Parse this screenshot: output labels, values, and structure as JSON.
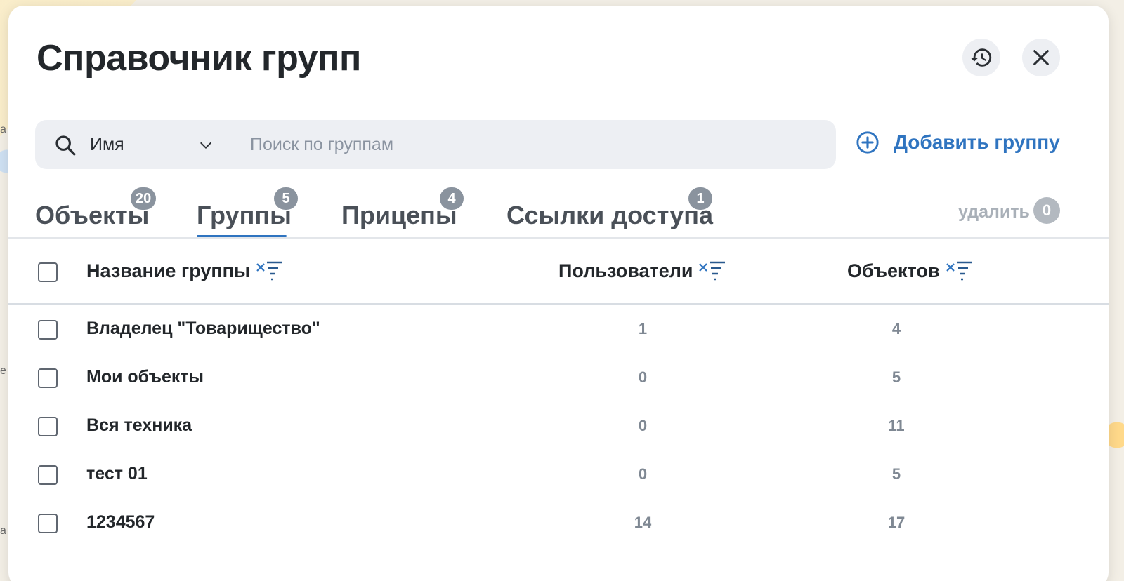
{
  "header": {
    "title": "Справочник групп"
  },
  "search": {
    "field_value": "Имя",
    "placeholder": "Поиск по группам"
  },
  "actions": {
    "add_group_label": "Добавить группу",
    "delete_label": "удалить",
    "delete_count": "0"
  },
  "tabs": [
    {
      "label": "Объекты",
      "count": "20"
    },
    {
      "label": "Группы",
      "count": "5",
      "active": true
    },
    {
      "label": "Прицепы",
      "count": "4"
    },
    {
      "label": "Ссылки доступа",
      "count": "1"
    }
  ],
  "table": {
    "columns": [
      "Название группы",
      "Пользователи",
      "Объектов"
    ],
    "rows": [
      {
        "name": "Владелец \"Товарищество\"",
        "users": "1",
        "objects": "4"
      },
      {
        "name": "Мои объекты",
        "users": "0",
        "objects": "5"
      },
      {
        "name": "Вся техника",
        "users": "0",
        "objects": "11"
      },
      {
        "name": "тест 01",
        "users": "0",
        "objects": "5"
      },
      {
        "name": "1234567",
        "users": "14",
        "objects": "17"
      }
    ]
  },
  "colors": {
    "accent": "#2f74c0",
    "badge": "#8a939e",
    "muted_text": "#7f8893"
  },
  "icons": [
    "history-icon",
    "close-icon",
    "search-icon",
    "chevron-down-icon",
    "plus-circle-icon",
    "sort-filter-icon"
  ]
}
